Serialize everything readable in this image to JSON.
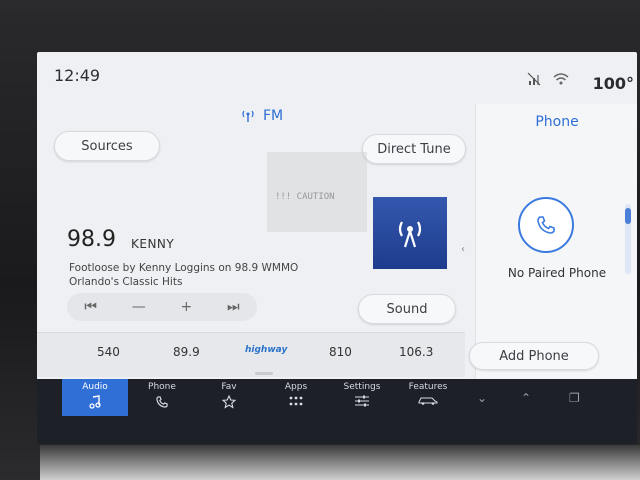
{
  "status": {
    "time": "12:49",
    "temperature": "100°"
  },
  "audio": {
    "band": "FM",
    "sources_label": "Sources",
    "direct_tune_label": "Direct Tune",
    "sound_label": "Sound",
    "frequency": "98.9",
    "station_name": "KENNY",
    "radio_text": "Footloose by Kenny Loggins on 98.9 WMMO Orlando's Classic Hits",
    "presets": [
      "540",
      "89.9",
      "810",
      "106.3"
    ],
    "preset_logo_text": "highway",
    "overlay_text": "!!! CAUTION"
  },
  "phone": {
    "title": "Phone",
    "status": "No Paired Phone",
    "add_label": "Add Phone"
  },
  "nav": {
    "tabs": [
      {
        "label": "Audio",
        "icon": "music-note-icon"
      },
      {
        "label": "Phone",
        "icon": "phone-icon"
      },
      {
        "label": "Fav",
        "icon": "star-icon"
      },
      {
        "label": "Apps",
        "icon": "apps-grid-icon"
      },
      {
        "label": "Settings",
        "icon": "sliders-icon"
      },
      {
        "label": "Features",
        "icon": "car-icon"
      }
    ]
  },
  "colors": {
    "accent": "#2f6fd6",
    "background": "#eef0f3",
    "nav": "#1d2026"
  }
}
